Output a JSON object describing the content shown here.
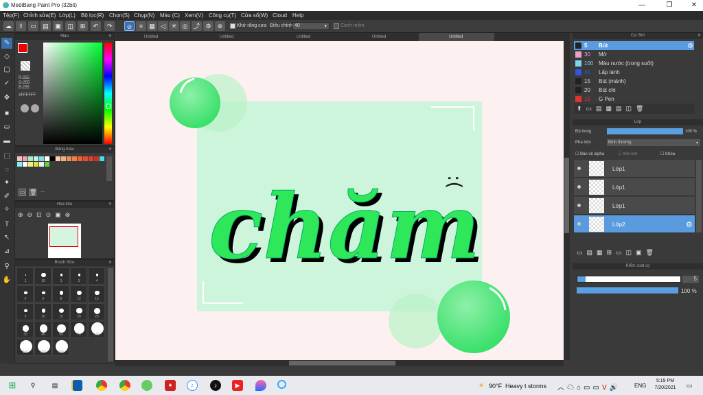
{
  "window": {
    "title": "MediBang Paint Pro (32bit)"
  },
  "menu": [
    "Tệp(F)",
    "Chỉnh sửa(E)",
    "Lớp(L)",
    "Bộ lọc(R)",
    "Chọn(S)",
    "Chụp(N)",
    "Màu (C)",
    "Xem(V)",
    "Công cụ(T)",
    "Cửa sổ(W)",
    "Cloud",
    "Help"
  ],
  "toolbar": {
    "antialias_label": "Khử răng cưa",
    "correction_label": "Điều chỉnh",
    "correction_value": "40",
    "snap_label": "Canh mềm"
  },
  "color_panel": {
    "title": "Màu",
    "r": "R:255",
    "g": "G:255",
    "b": "B:255",
    "hex": "#FFFFFF"
  },
  "palette_panel": {
    "title": "Bảng màu",
    "sep": "---"
  },
  "navigator_panel": {
    "title": "Hoa tiêu"
  },
  "brushsize_panel": {
    "title": "Brush Size",
    "sizes": [
      "1",
      "15",
      "3",
      "3",
      "4",
      "5",
      "6",
      "8",
      "12",
      "15",
      "5",
      "10",
      "15",
      "20",
      "25",
      "30",
      "40",
      "50",
      "70",
      "100",
      "150",
      "200",
      "300"
    ]
  },
  "tabs": [
    "Untitled",
    "Untitled",
    "Untitled",
    "Untitled",
    "Untitled"
  ],
  "artwork": {
    "word": "chăm",
    "face": ":("
  },
  "brush_panel": {
    "title": "Cọ: Bút",
    "items": [
      {
        "size": "5",
        "name": "Bút",
        "color": "#222222"
      },
      {
        "size": "30",
        "name": "Mờ",
        "color": "#e8a0c8"
      },
      {
        "size": "100",
        "name": "Màu nước (trong suốt)",
        "color": "#7fd4f0"
      },
      {
        "size": "30",
        "name": "Lấp lánh",
        "color": "#3355dd"
      },
      {
        "size": "15",
        "name": "Bút (mảnh)",
        "color": "#222222"
      },
      {
        "size": "20",
        "name": "Bút chì",
        "color": "#222222"
      },
      {
        "size": "15",
        "name": "G Pen",
        "color": "#dd3333"
      }
    ]
  },
  "layer_panel": {
    "title": "Lớp",
    "opacity_label": "Độ trong",
    "opacity_value": "100 %",
    "opacity_fraction": 1.0,
    "blend_label": "Pha trộn",
    "blend_value": "Bình thường",
    "protect_alpha": "Bảo vệ alpha",
    "clipping": "Xén bớt",
    "lock": "Khóa",
    "layers": [
      "Lớp1",
      "Lớp1",
      "Lớp1",
      "Lớp2"
    ],
    "selected_index": 3
  },
  "brush_control": {
    "title": "Kiểm soát cọ",
    "size_value": "5",
    "opacity_value": "100 %",
    "opacity_fraction": 1.0,
    "size_fraction": 0.08
  },
  "taskbar": {
    "weather_temp": "90°F",
    "weather_text": "Heavy t storms",
    "lang": "ENG",
    "time": "5:19 PM",
    "date": "7/20/2021"
  }
}
